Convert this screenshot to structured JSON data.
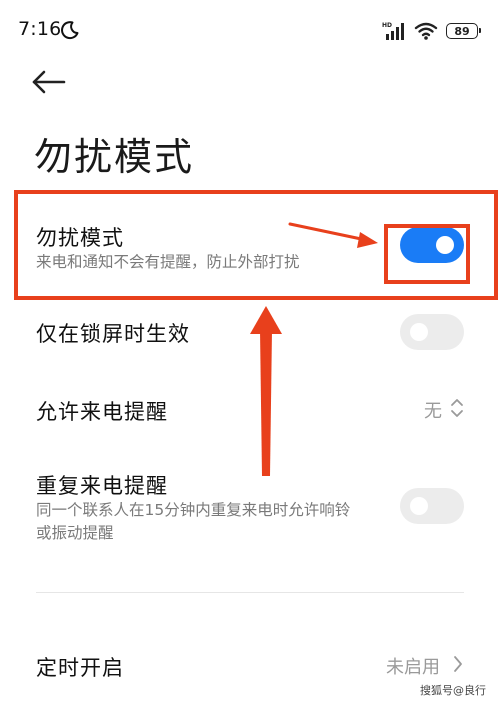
{
  "status_bar": {
    "time": "7:16",
    "battery": "89",
    "icons": [
      "moon-icon",
      "signal-icon",
      "wifi-icon",
      "battery-icon"
    ]
  },
  "header": {
    "back_icon": "back-arrow-icon",
    "title": "勿扰模式"
  },
  "settings": {
    "dnd": {
      "title": "勿扰模式",
      "subtitle": "来电和通知不会有提醒，防止外部打扰",
      "enabled": true
    },
    "lockscreen_only": {
      "title": "仅在锁屏时生效",
      "enabled": false
    },
    "allow_calls": {
      "title": "允许来电提醒",
      "value": "无",
      "icon": "updown-chevron-icon"
    },
    "repeat_calls": {
      "title": "重复来电提醒",
      "subtitle_line1": "同一个联系人在15分钟内重复来电时允许响铃",
      "subtitle_line2": "或振动提醒",
      "enabled": false
    },
    "scheduled": {
      "title": "定时开启",
      "value": "未启用",
      "icon": "chevron-right-icon"
    }
  },
  "colors": {
    "accent": "#1a7cf6",
    "annotation": "#e8401c",
    "toggle_off": "#ececec",
    "secondary_text": "#7a7a7a"
  },
  "watermark": "搜狐号@良行"
}
